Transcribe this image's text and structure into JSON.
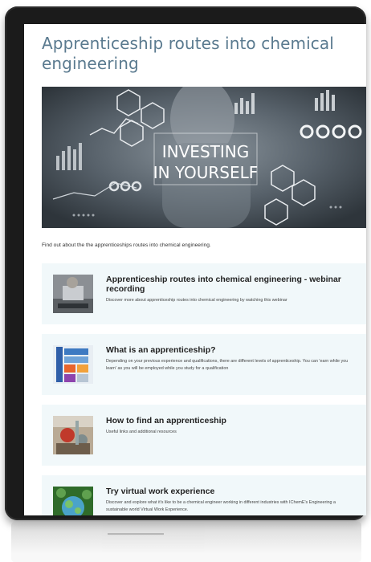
{
  "page": {
    "title": "Apprenticeship routes into chemical engineering",
    "intro": "Find out about the the apprenticeships routes into chemical engineering."
  },
  "hero": {
    "headline_1": "INVESTING",
    "headline_2": "IN YOURSELF"
  },
  "cards": [
    {
      "title": "Apprenticeship routes into chemical engineering - webinar recording",
      "description": "Discover more about apprenticeship routes into chemical engineering by watching this webinar"
    },
    {
      "title": "What is an apprenticeship?",
      "description": "Depending on your previous experience and qualifications, there are different levels of apprenticeship. You can 'earn while you learn' as you will be employed while you study for a qualification"
    },
    {
      "title": "How to find an apprenticeship",
      "description": "Useful links and additional resources"
    },
    {
      "title": "Try virtual work experience",
      "description": "Discover and explore what it's like to be a chemical engineer working in different industries with IChemE's Engineering a sustainable world Virtual Work Experience."
    }
  ],
  "colors": {
    "title": "#5a7a8f",
    "card_bg": "#f1f8fa",
    "device": "#1b1b1b"
  }
}
